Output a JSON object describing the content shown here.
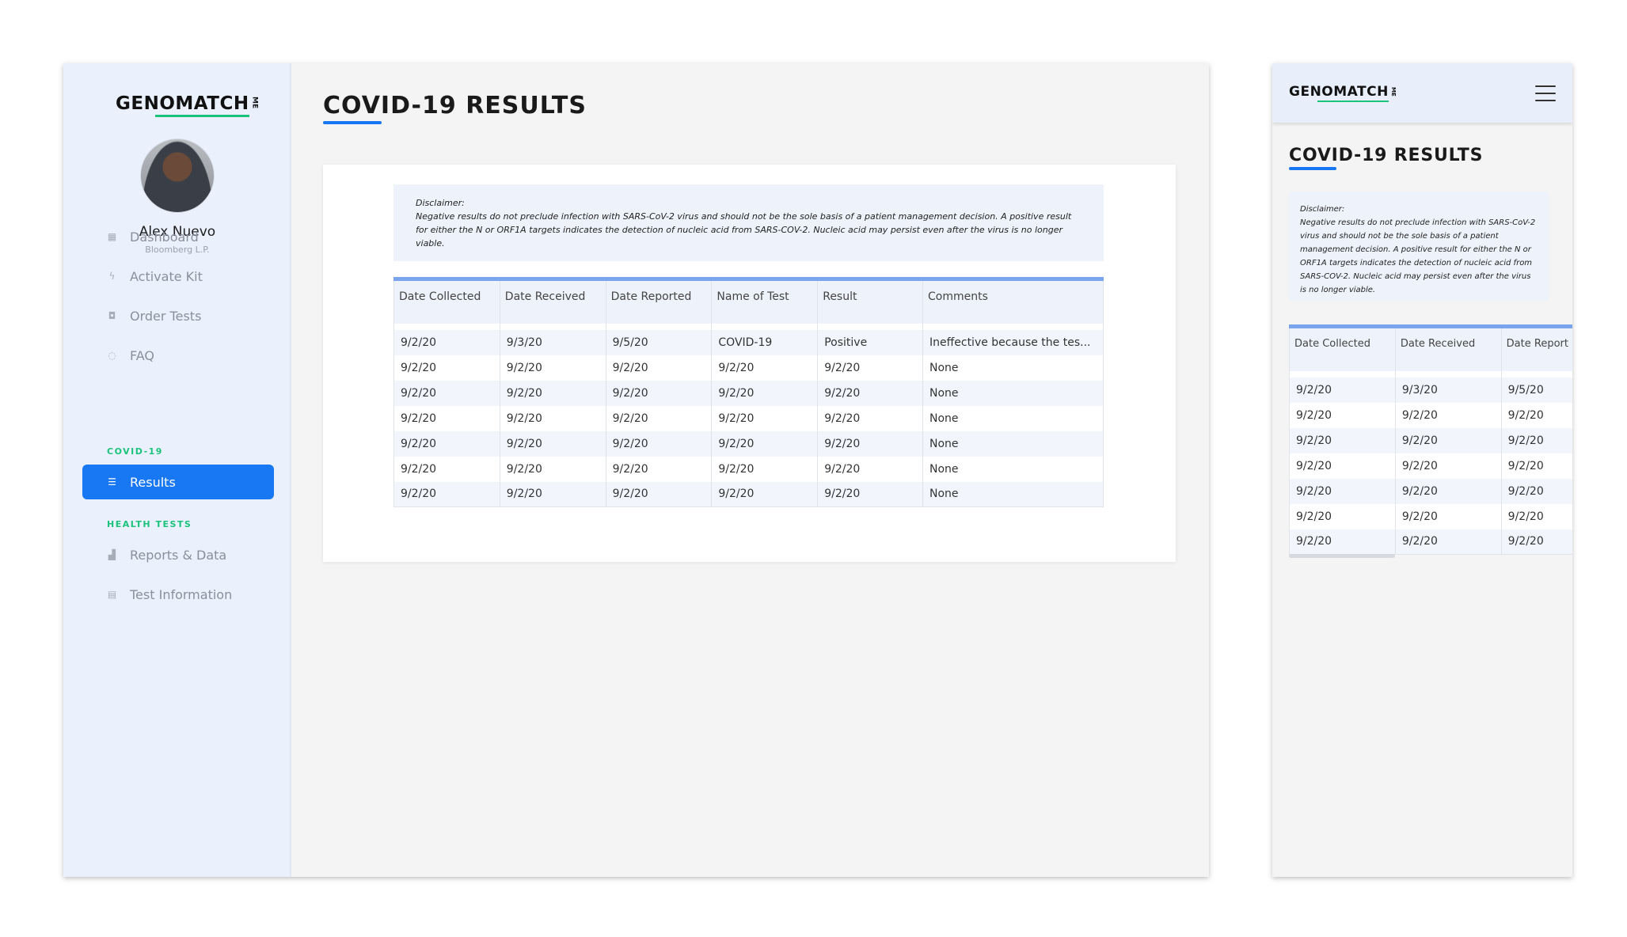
{
  "brand": {
    "name": "GENOMATCH",
    "suffix": "ME"
  },
  "user": {
    "name": "Alex Nuevo",
    "org": "Bloomberg L.P."
  },
  "nav": {
    "items": [
      {
        "label": "Dashboard",
        "icon": "dashboard-icon"
      },
      {
        "label": "Activate Kit",
        "icon": "bolt-icon"
      },
      {
        "label": "Order Tests",
        "icon": "bag-icon"
      },
      {
        "label": "FAQ",
        "icon": "chat-icon"
      }
    ],
    "covid_section": "COVID-19",
    "covid_items": [
      {
        "label": "Results",
        "icon": "list-icon"
      }
    ],
    "health_section": "HEALTH TESTS",
    "health_items": [
      {
        "label": "Reports & Data",
        "icon": "chart-icon"
      },
      {
        "label": "Test Information",
        "icon": "document-icon"
      }
    ]
  },
  "page": {
    "title": "COVID-19 RESULTS"
  },
  "disclaimer": {
    "heading": "Disclaimer:",
    "text": "Negative results do not preclude infection with SARS-CoV-2 virus and should not be the sole basis of a patient management decision. A positive result for either the N or ORF1A targets indicates the detection of nucleic acid from SARS-COV-2. Nucleic acid may persist even after the virus is no longer viable."
  },
  "table": {
    "headers": [
      "Date Collected",
      "Date Received",
      "Date Reported",
      "Name of Test",
      "Result",
      "Comments"
    ],
    "rows": [
      [
        "9/2/20",
        "9/3/20",
        "9/5/20",
        "COVID-19",
        "Positive",
        "Ineffective because the tes..."
      ],
      [
        "9/2/20",
        "9/2/20",
        "9/2/20",
        "9/2/20",
        "9/2/20",
        "None"
      ],
      [
        "9/2/20",
        "9/2/20",
        "9/2/20",
        "9/2/20",
        "9/2/20",
        "None"
      ],
      [
        "9/2/20",
        "9/2/20",
        "9/2/20",
        "9/2/20",
        "9/2/20",
        "None"
      ],
      [
        "9/2/20",
        "9/2/20",
        "9/2/20",
        "9/2/20",
        "9/2/20",
        "None"
      ],
      [
        "9/2/20",
        "9/2/20",
        "9/2/20",
        "9/2/20",
        "9/2/20",
        "None"
      ],
      [
        "9/2/20",
        "9/2/20",
        "9/2/20",
        "9/2/20",
        "9/2/20",
        "None"
      ]
    ]
  },
  "mobile": {
    "headers": [
      "Date Collected",
      "Date Received",
      "Date Report"
    ]
  },
  "colors": {
    "accent": "#1877f2",
    "section": "#1bc27a",
    "sidebar": "#eaf1fd",
    "table_header_rule": "#7ba4ee"
  }
}
